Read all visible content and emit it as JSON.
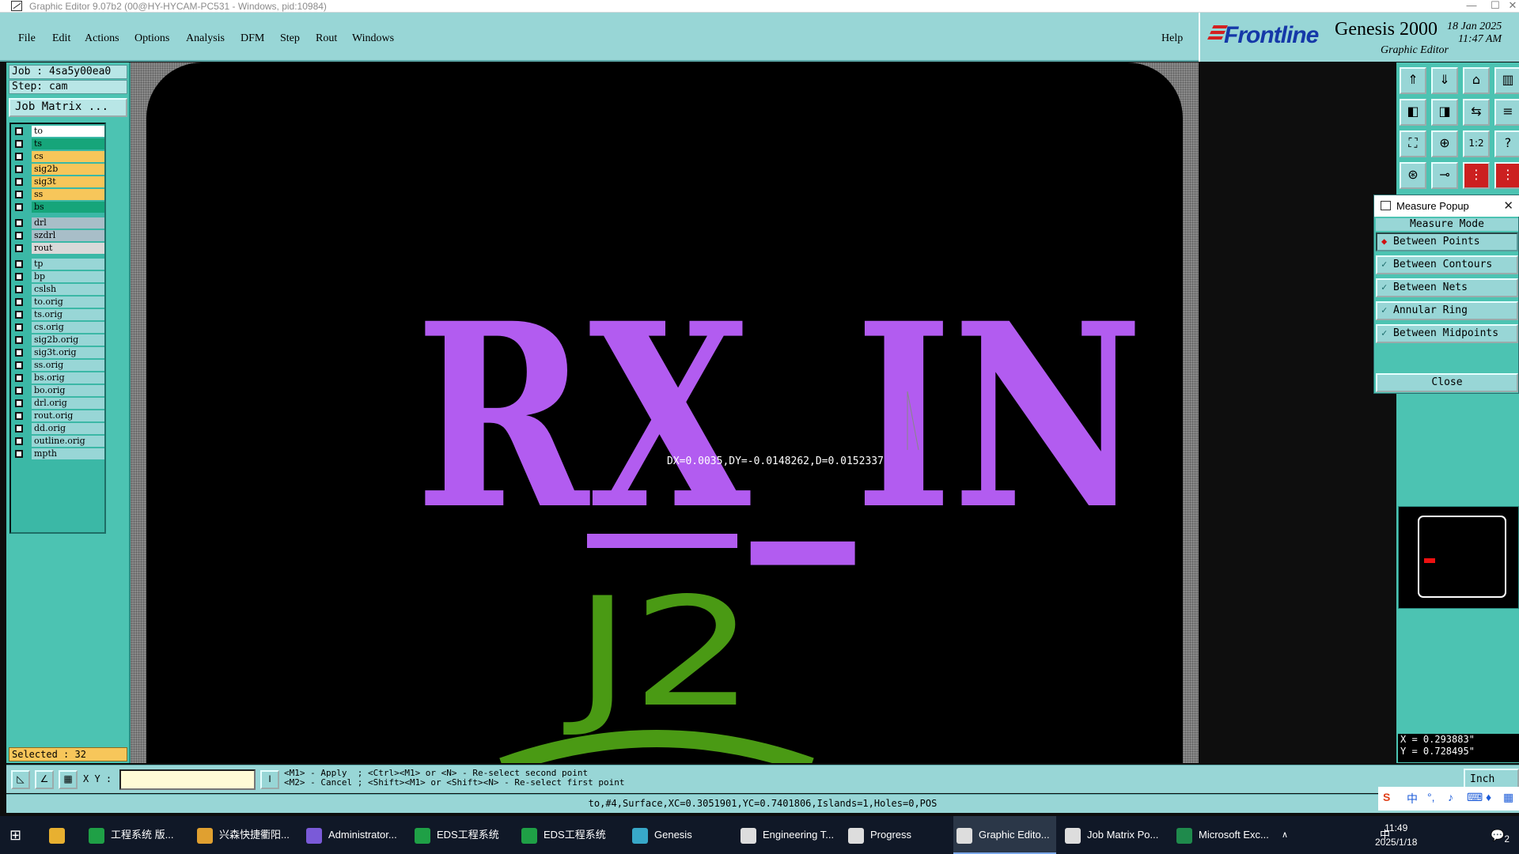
{
  "window": {
    "title": "Graphic Editor 9.07b2 (00@HY-HYCAM-PC531 - Windows, pid:10984)",
    "controls": [
      "—",
      "☐",
      "✕"
    ]
  },
  "menu": {
    "items": [
      "File",
      "Edit",
      "Actions",
      "Options",
      "Analysis",
      "DFM",
      "Step",
      "Rout",
      "Windows"
    ],
    "help": "Help"
  },
  "brand": {
    "logo": "Frontline",
    "product": "Genesis 2000",
    "subtitle": "Graphic Editor",
    "date": "18 Jan 2025",
    "time": "11:47 AM"
  },
  "job": {
    "job_label": "Job : 4sa5y00ea0",
    "step_label": "Step: cam",
    "matrix_button": "Job Matrix ...",
    "selected": "Selected : 32"
  },
  "layers": [
    {
      "name": "to",
      "color": "#ffffff"
    },
    {
      "name": "ts",
      "color": "#16a57a"
    },
    {
      "name": "cs",
      "color": "#f7c65a"
    },
    {
      "name": "sig2b",
      "color": "#f7c65a"
    },
    {
      "name": "sig3t",
      "color": "#f7c65a"
    },
    {
      "name": "ss",
      "color": "#f7c65a"
    },
    {
      "name": "bs",
      "color": "#16a57a"
    },
    {
      "name": "drl",
      "color": "#a8bec8"
    },
    {
      "name": "szdrl",
      "color": "#a8bec8"
    },
    {
      "name": "rout",
      "color": "#d9d9d9"
    },
    {
      "name": "tp",
      "color": "#98d6d6"
    },
    {
      "name": "bp",
      "color": "#98d6d6"
    },
    {
      "name": "cslsh",
      "color": "#98d6d6"
    },
    {
      "name": "to.orig",
      "color": "#98d6d6"
    },
    {
      "name": "ts.orig",
      "color": "#98d6d6"
    },
    {
      "name": "cs.orig",
      "color": "#98d6d6"
    },
    {
      "name": "sig2b.orig",
      "color": "#98d6d6"
    },
    {
      "name": "sig3t.orig",
      "color": "#98d6d6"
    },
    {
      "name": "ss.orig",
      "color": "#98d6d6"
    },
    {
      "name": "bs.orig",
      "color": "#98d6d6"
    },
    {
      "name": "bo.orig",
      "color": "#98d6d6"
    },
    {
      "name": "drl.orig",
      "color": "#98d6d6"
    },
    {
      "name": "rout.orig",
      "color": "#98d6d6"
    },
    {
      "name": "dd.orig",
      "color": "#98d6d6"
    },
    {
      "name": "outline.orig",
      "color": "#98d6d6"
    },
    {
      "name": "mpth",
      "color": "#98d6d6"
    }
  ],
  "canvas": {
    "text_main": "RX_IN",
    "text_ref": "J2",
    "measure_readout": "DX=0.0035,DY=-0.0148262,D=0.0152337",
    "colors": {
      "board": "#000000",
      "main_text": "#b25cf0",
      "ref_text": "#4a9a14",
      "dots": "#5e5e5e"
    }
  },
  "toolbar": {
    "icons": [
      "page-up-icon",
      "page-down-icon",
      "home-icon",
      "layout-icon",
      "pan-left-icon",
      "pan-right-icon",
      "swap-icon",
      "step-icon",
      "zoom-fit-icon",
      "zoom-out-icon",
      "zoom-1to1-icon",
      "help-icon",
      "snap-icon",
      "pin-icon",
      "netlist-icon",
      "circuit-icon"
    ],
    "glyphs": [
      "⇑",
      "⇓",
      "⌂",
      "▥",
      "◧",
      "◨",
      "⇆",
      "≡",
      "⛶",
      "⊕",
      "1:2",
      "?",
      "⊛",
      "⊸",
      "⋮",
      "⋮"
    ]
  },
  "measure_popup": {
    "title": "Measure Popup",
    "mode_label": "Measure Mode",
    "options": [
      "Between Points",
      "Between Contours",
      "Between Nets",
      "Annular Ring",
      "Between Midpoints"
    ],
    "active_option": "Between Points",
    "close_label": "Close"
  },
  "coords": {
    "x": "X = 0.293883\"",
    "y": "Y = 0.728495\""
  },
  "command": {
    "xy_label": "X Y :",
    "xy_value": "",
    "hint_line1": "<M1> - Apply  ; <Ctrl><M1> or <N> - Re-select second point",
    "hint_line2": "<M2> - Cancel ; <Shift><M1> or <Shift><N> - Re-select first point",
    "units": "Inch"
  },
  "status": {
    "text": "to,#4,Surface,XC=0.3051901,YC=0.7401806,Islands=1,Holes=0,POS"
  },
  "taskbar": {
    "items": [
      {
        "label": "工程系统  版...",
        "icon_color": "#1fa046"
      },
      {
        "label": "兴森快捷衢阳...",
        "icon_color": "#e0a030"
      },
      {
        "label": "Administrator...",
        "icon_color": "#7a5ad8"
      },
      {
        "label": "EDS工程系统",
        "icon_color": "#1fa046"
      },
      {
        "label": "EDS工程系统",
        "icon_color": "#1fa046"
      },
      {
        "label": "Genesis",
        "icon_color": "#38a8c8"
      },
      {
        "label": "Engineering T...",
        "icon_color": "#dddddd"
      },
      {
        "label": "Progress",
        "icon_color": "#dddddd"
      },
      {
        "label": "Graphic Edito...",
        "icon_color": "#dddddd"
      },
      {
        "label": "Job Matrix Po...",
        "icon_color": "#dddddd"
      },
      {
        "label": "Microsoft Exc...",
        "icon_color": "#1f8a4c"
      }
    ],
    "active": "Graphic Edito...",
    "time": "11:49",
    "date": "2025/1/18",
    "ime": "中",
    "notification_count": "2"
  }
}
